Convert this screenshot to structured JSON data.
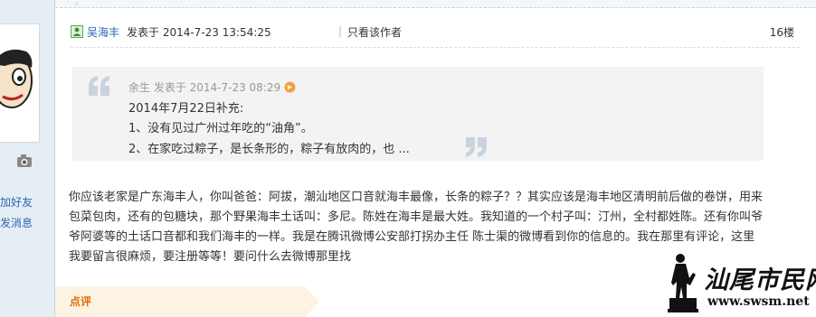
{
  "sidebar": {
    "links": [
      "加好友",
      "发消息"
    ]
  },
  "post": {
    "author": "吴海丰",
    "meta": "发表于 2014-7-23 13:54:25",
    "separator": "|",
    "only_author": "只看该作者",
    "floor": "16楼"
  },
  "quote": {
    "meta": "余生 发表于 2014-7-23 08:29",
    "lines": [
      "2014年7月22日补充:",
      "1、没有见过广州过年吃的“油角”。",
      "2、在家吃过粽子，是长条形的，粽子有放肉的，也 ..."
    ]
  },
  "body": {
    "text": "你应该老家是广东海丰人，你叫爸爸：阿拔，潮汕地区口音就海丰最像，长条的粽子？？其实应该是海丰地区清明前后做的卷饼，用来包菜包肉，还有的包糖块，那个野果海丰土话叫：多尼。陈姓在海丰是最大姓。我知道的一个村子叫：汀州，全村都姓陈。还有你叫爷爷阿婆等的土话口音都和我们海丰的一样。我是在腾讯微博公安部打拐办主任 陈士渠的微博看到你的信息的。我在那里有评论，这里我要留言很麻烦，要注册等等！要问什么去微博那里找"
  },
  "comment": {
    "label": "点评"
  },
  "watermark": {
    "title": "汕尾市民网",
    "url": "www.swsm.net"
  },
  "colors": {
    "link": "#2d64b3",
    "accent": "#e06c0c",
    "quote_bg": "#f3f3f3",
    "sidebar_bg": "#e6eef5"
  },
  "icons": [
    "online-icon",
    "camera-icon",
    "quote-open-icon",
    "quote-close-icon",
    "goto-post-icon"
  ]
}
